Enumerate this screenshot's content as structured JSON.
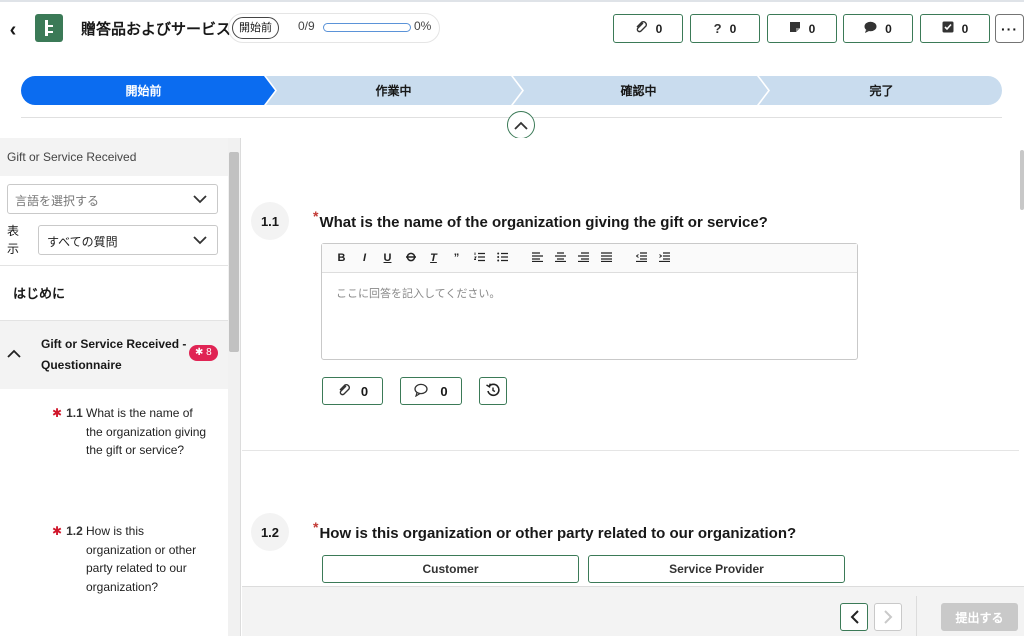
{
  "header": {
    "title": "贈答品およびサービス",
    "status": "開始前",
    "progress_count": "0/9",
    "progress_percent": "0%",
    "progress_value": 0,
    "buttons": [
      {
        "name": "attachments",
        "icon": "paperclip-icon",
        "count": "0"
      },
      {
        "name": "questions",
        "icon": "question-icon",
        "count": "0"
      },
      {
        "name": "notes",
        "icon": "note-icon",
        "count": "0"
      },
      {
        "name": "comments",
        "icon": "comment-icon",
        "count": "0"
      },
      {
        "name": "tasks",
        "icon": "checkbox-icon",
        "count": "0"
      }
    ],
    "more": "···"
  },
  "path": {
    "steps": [
      "開始前",
      "作業中",
      "確認中",
      "完了"
    ],
    "active_index": 0,
    "active_color": "#0b6cf0",
    "inactive_color": "#c9dcee"
  },
  "sidebar": {
    "header": "Gift or Service Received",
    "language_placeholder": "言語を選択する",
    "show_label": "表示",
    "filter_value": "すべての質問",
    "intro": "はじめに",
    "section_title": "Gift or Service Received - Questionnaire",
    "section_badge": "8",
    "questions": [
      {
        "num": "1.1",
        "text": "What is the name of the organization giving the gift or service?"
      },
      {
        "num": "1.2",
        "text": "How is this organization or other party related to our organization?"
      }
    ]
  },
  "main": {
    "q1": {
      "num": "1.1",
      "text": "What is the name of the organization giving the gift or service?",
      "placeholder": "ここに回答を記入してください。",
      "attachments_count": "0",
      "comments_count": "0"
    },
    "q2": {
      "num": "1.2",
      "text": "How is this organization or other party related to our organization?",
      "choices": [
        "Customer",
        "Service Provider"
      ]
    }
  },
  "footer": {
    "submit_label": "提出する"
  },
  "colors": {
    "brand_green": "#3b7a57",
    "active_blue": "#0b6cf0",
    "required_red": "#c23934",
    "badge_red": "#e02454"
  }
}
